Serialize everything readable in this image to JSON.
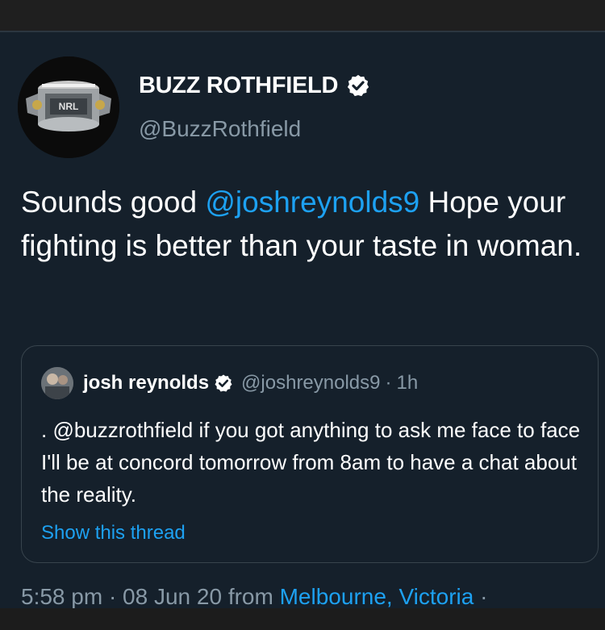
{
  "author": {
    "display_name": "BUZZ ROTHFIELD",
    "handle": "@BuzzRothfield",
    "avatar_text": "NRL"
  },
  "tweet": {
    "text_before": "Sounds good ",
    "mention": "@joshreynolds9",
    "text_after": " Hope your fighting is better than your taste in woman."
  },
  "quoted": {
    "name": "josh reynolds",
    "handle": "@joshreynolds9",
    "separator": "·",
    "time": "1h",
    "text": ". @buzzrothfield if you got anything to ask me face to face I'll be at concord tomorrow from 8am to have a chat about the reality.",
    "show_thread": "Show this thread"
  },
  "meta": {
    "time_date": "5:58 pm · 08 Jun 20 from ",
    "location": "Melbourne, Victoria",
    "trailing": " ·"
  },
  "colors": {
    "background": "#15202b",
    "link": "#1da1f2",
    "secondary_text": "#8899a6",
    "border": "#38444d"
  }
}
